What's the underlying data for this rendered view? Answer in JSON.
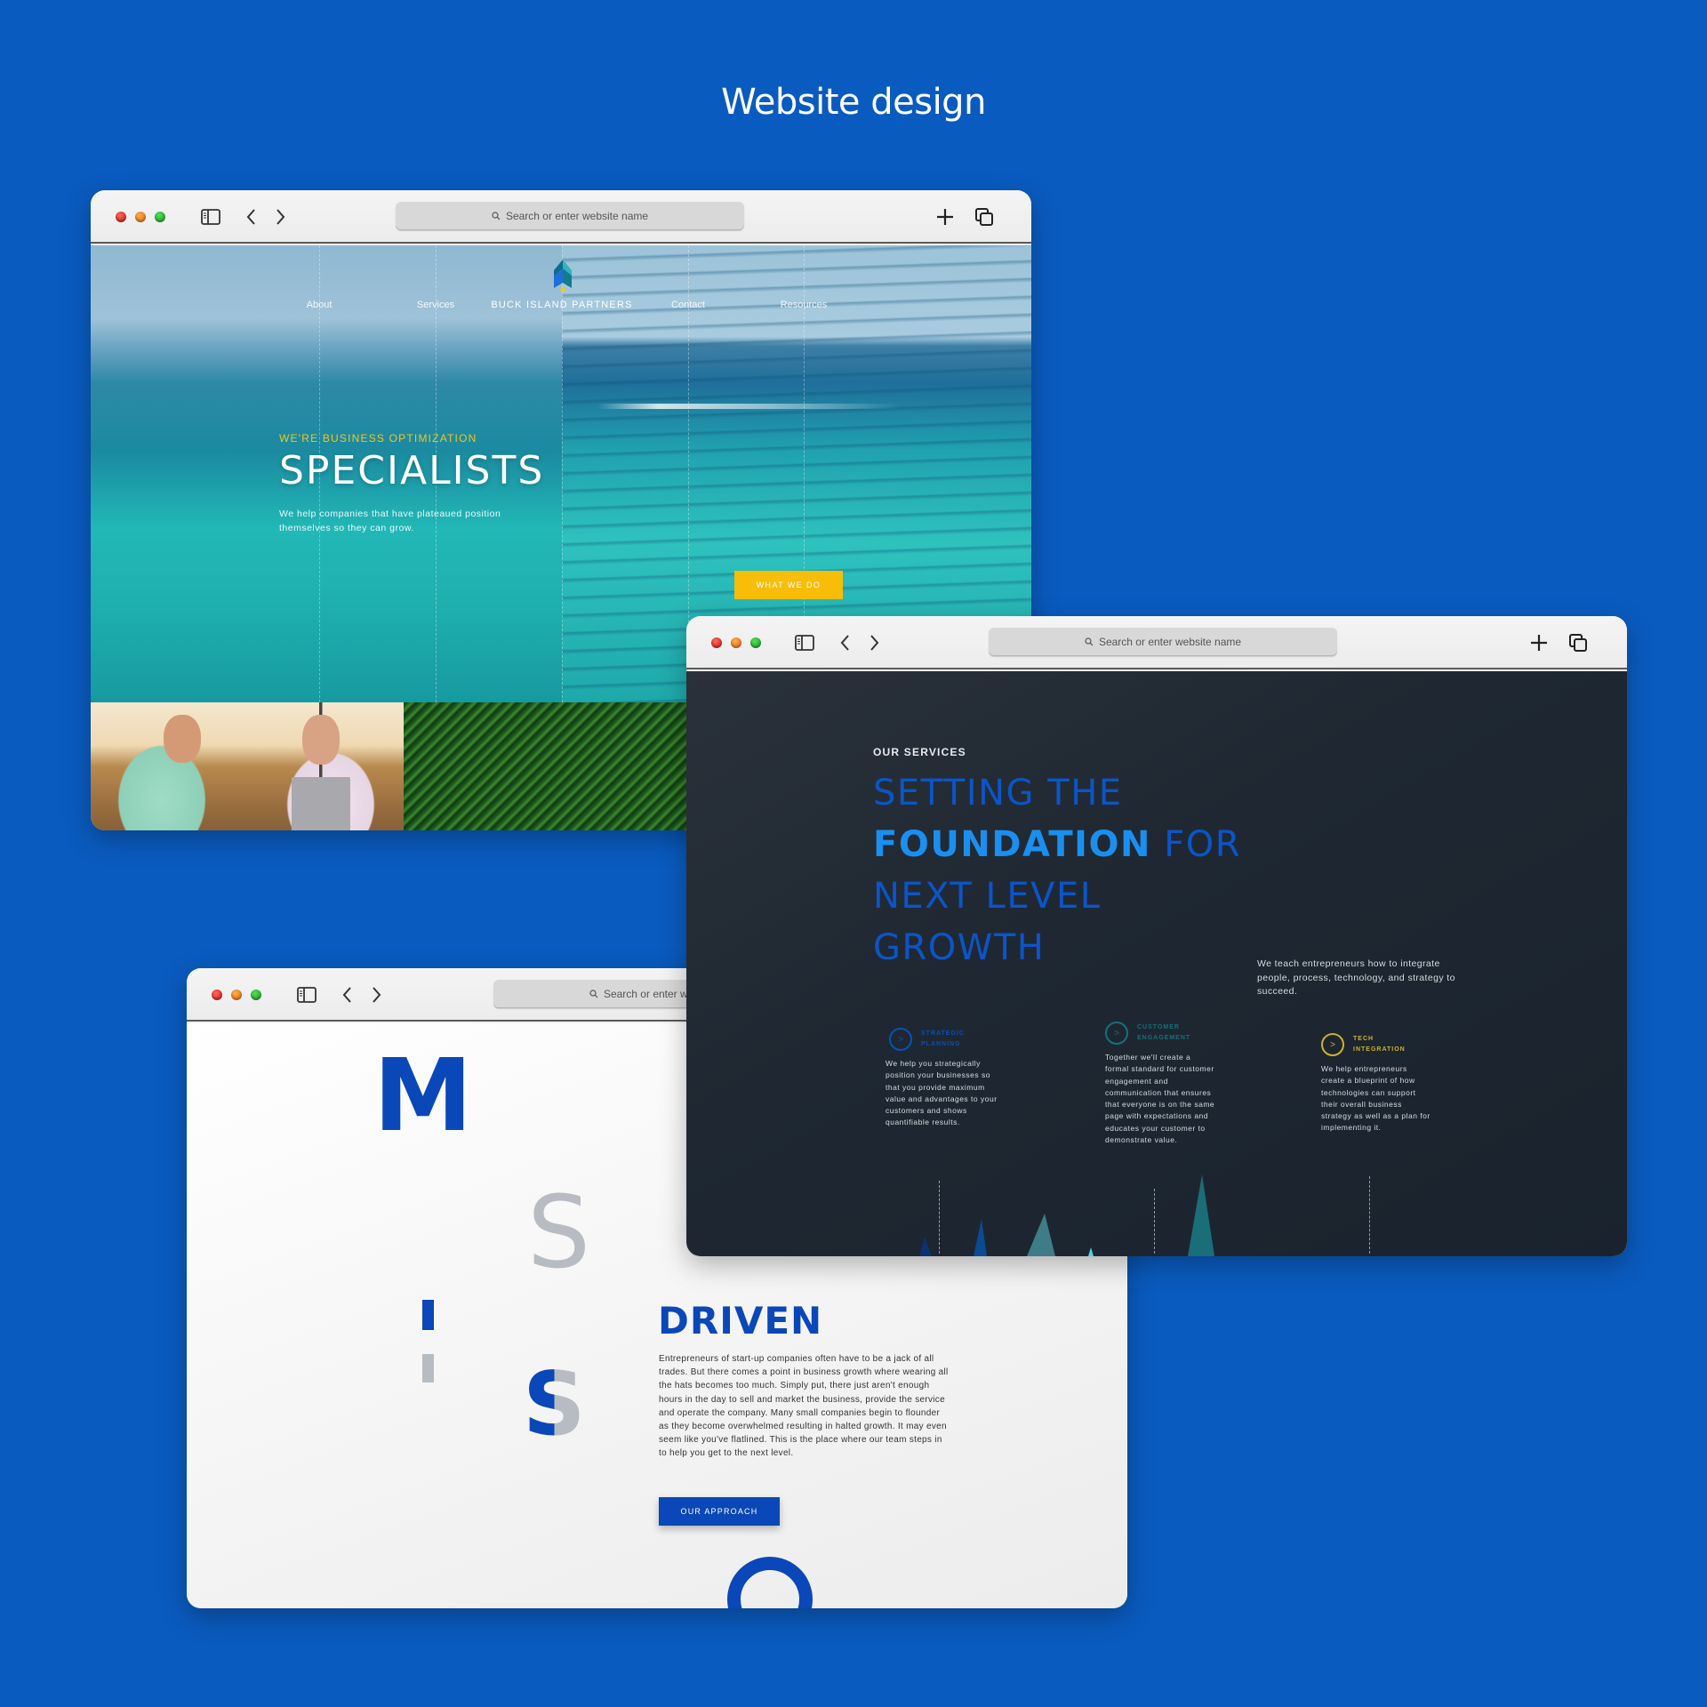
{
  "page": {
    "title": "Website design"
  },
  "browser_chrome": {
    "address_placeholder": "Search or enter website name",
    "address_placeholder_truncated": "Search or enter we",
    "icons": [
      "sidebar-icon",
      "back-chevron-icon",
      "forward-chevron-icon",
      "search-icon",
      "new-tab-plus-icon",
      "tabs-overview-icon"
    ]
  },
  "hero_site": {
    "nav": {
      "items": [
        "About",
        "Services",
        "Contact",
        "Resources"
      ],
      "brand": "BUCK ISLAND PARTNERS"
    },
    "eyebrow": "WE'RE BUSINESS OPTIMIZATION",
    "headline": "SPECIALISTS",
    "subtext": "We help companies that have plateaued position themselves so they can grow.",
    "cta_label": "WHAT WE DO",
    "colors": {
      "accent": "#f8bd08"
    }
  },
  "services_site": {
    "eyebrow": "OUR SERVICES",
    "headline": {
      "line1": "SETTING THE",
      "line2_strong": "FOUNDATION",
      "line2_rest": " FOR",
      "line3": "NEXT LEVEL",
      "line4": "GROWTH"
    },
    "intro": "We teach entrepreneurs how to integrate people, process, technology, and strategy to succeed.",
    "services": [
      {
        "title_line1": "STRATEGIC",
        "title_line2": "PLANNING",
        "icon": ">",
        "body": "We help you strategically position your businesses so that you provide maximum value and advantages to your customers and shows quantifiable results.",
        "color": "#0b4fb8"
      },
      {
        "title_line1": "CUSTOMER",
        "title_line2": "ENGAGEMENT",
        "icon": ">",
        "body": "Together we'll create a formal standard for customer engagement and communication that ensures that everyone is on the same page with expectations and educates your customer to demonstrate value.",
        "color": "#14707c"
      },
      {
        "title_line1": "TECH",
        "title_line2": "INTEGRATION",
        "icon": ">",
        "body": "We help entrepreneurs create a blueprint of how technologies can support their overall business strategy as well as a plan for implementing it.",
        "color": "#cdb22a"
      }
    ]
  },
  "mission_site": {
    "letters": {
      "m": "M",
      "s1": "S",
      "s2": "S"
    },
    "title": "DRIVEN",
    "body": "Entrepreneurs of start-up companies often have to be a jack of all trades. But there comes a point in business growth where wearing all the hats becomes too much. Simply put, there just aren't enough hours in the day to sell and market the business, provide the service and operate the company. Many small companies begin to flounder as they become overwhelmed resulting in halted growth. It may even seem like you've flatlined. This is the place where our team steps in to help you get to the next level.",
    "cta_label": "OUR APPROACH",
    "colors": {
      "primary": "#0a47b8",
      "muted": "#b7bcc2"
    }
  }
}
